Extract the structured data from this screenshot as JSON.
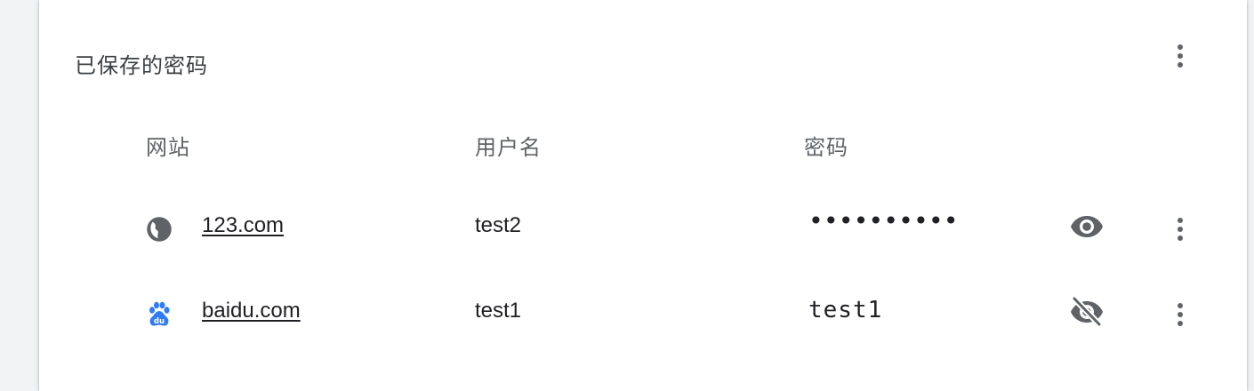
{
  "section": {
    "title": "已保存的密码",
    "menu_icon": "more-vert-icon"
  },
  "columns": {
    "website": "网站",
    "username": "用户名",
    "password": "密码"
  },
  "rows": [
    {
      "site": "123.com",
      "site_icon": "globe-icon",
      "username": "test2",
      "password": "••••••••••",
      "password_visible": false,
      "toggle_icon": "eye-icon",
      "menu_icon": "more-vert-icon"
    },
    {
      "site": "baidu.com",
      "site_icon": "baidu-paw-icon",
      "username": "test1",
      "password": "test1",
      "password_visible": true,
      "toggle_icon": "eye-off-icon",
      "menu_icon": "more-vert-icon"
    }
  ],
  "colors": {
    "icon_gray": "#5f6368",
    "baidu_blue": "#2f7cf6",
    "text": "#202124"
  }
}
